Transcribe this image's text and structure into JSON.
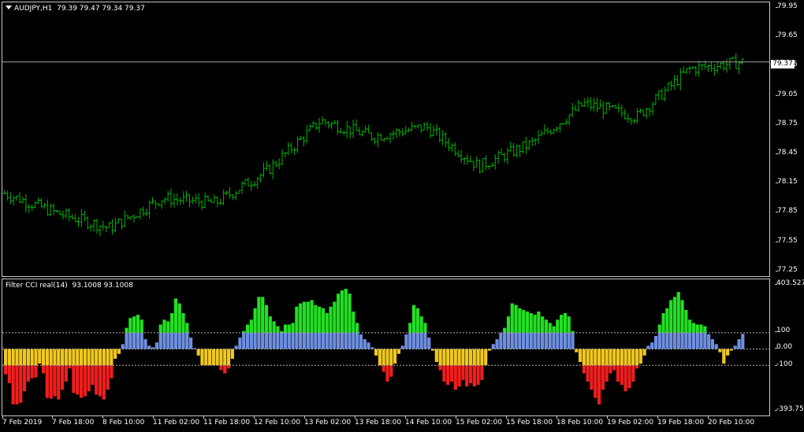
{
  "main": {
    "symbol": "AUDJPY,H1",
    "ohlc": "79.39 79.47 79.34 79.37",
    "current_price": "79.37",
    "price_ticks": [
      "79.95",
      "79.65",
      "79.35",
      "79.05",
      "78.75",
      "78.45",
      "78.15",
      "77.85",
      "77.55",
      "77.25"
    ]
  },
  "indicator": {
    "title": "Filter CCI real(14)",
    "values": "93.1008 93.1008",
    "ticks": [
      "403.5276",
      "100",
      "0.00",
      "-100",
      "-393.7543"
    ]
  },
  "time_labels": [
    "7 Feb 2019",
    "7 Feb 18:00",
    "8 Feb 10:00",
    "11 Feb 02:00",
    "11 Feb 18:00",
    "12 Feb 10:00",
    "13 Feb 02:00",
    "13 Feb 18:00",
    "14 Feb 10:00",
    "15 Feb 02:00",
    "15 Feb 18:00",
    "18 Feb 10:00",
    "19 Feb 02:00",
    "19 Feb 18:00",
    "20 Feb 10:00"
  ],
  "colors": {
    "bars": "#00b400",
    "cci_up_strong": "#22e022",
    "cci_up": "#6e8fe0",
    "cci_down": "#f0c81e",
    "cci_down_strong": "#f01e1e"
  },
  "chart_data": [
    {
      "type": "line",
      "title": "AUDJPY,H1",
      "ylim": [
        77.2,
        79.97
      ],
      "x": [
        "7 Feb 2019",
        "7 Feb 18:00",
        "8 Feb 10:00",
        "11 Feb 02:00",
        "11 Feb 18:00",
        "12 Feb 10:00",
        "13 Feb 02:00",
        "13 Feb 18:00",
        "14 Feb 10:00",
        "15 Feb 02:00",
        "15 Feb 18:00",
        "18 Feb 10:00",
        "19 Feb 02:00",
        "19 Feb 18:00",
        "20 Feb 10:00"
      ],
      "series": [
        {
          "values": [
            78.05,
            77.85,
            77.7,
            78.0,
            77.95,
            78.28,
            78.78,
            78.62,
            78.72,
            78.32,
            78.55,
            78.95,
            78.82,
            79.3,
            79.37
          ]
        }
      ]
    },
    {
      "type": "bar",
      "title": "Filter CCI real(14)",
      "ylim": [
        -393.7543,
        403.5276
      ],
      "values": [
        -155,
        -210,
        -340,
        -340,
        -330,
        -260,
        -200,
        -180,
        -175,
        -90,
        -150,
        -300,
        -305,
        -290,
        -310,
        -250,
        -200,
        -120,
        -270,
        -280,
        -300,
        -290,
        -260,
        -220,
        -280,
        -290,
        -310,
        -250,
        -180,
        -60,
        -30,
        30,
        130,
        190,
        200,
        210,
        180,
        60,
        20,
        10,
        40,
        150,
        180,
        170,
        220,
        310,
        280,
        220,
        160,
        70,
        5,
        -40,
        -100,
        -100,
        -100,
        -100,
        -100,
        -130,
        -150,
        -120,
        -60,
        20,
        70,
        110,
        150,
        180,
        250,
        320,
        320,
        270,
        200,
        170,
        140,
        110,
        150,
        150,
        160,
        260,
        280,
        290,
        290,
        300,
        270,
        260,
        250,
        220,
        260,
        290,
        340,
        360,
        370,
        340,
        230,
        160,
        90,
        60,
        40,
        10,
        -40,
        -100,
        -140,
        -200,
        -170,
        -90,
        -30,
        20,
        90,
        160,
        270,
        250,
        200,
        160,
        70,
        -10,
        -80,
        -130,
        -200,
        -220,
        -200,
        -250,
        -230,
        -190,
        -230,
        -210,
        -230,
        -220,
        -190,
        -100,
        -10,
        30,
        60,
        100,
        130,
        200,
        280,
        270,
        250,
        240,
        230,
        220,
        210,
        230,
        200,
        180,
        160,
        140,
        180,
        210,
        220,
        200,
        110,
        -20,
        -80,
        -150,
        -200,
        -250,
        -300,
        -340,
        -250,
        -200,
        -150,
        -130,
        -200,
        -220,
        -260,
        -240,
        -200,
        -120,
        -90,
        -40,
        20,
        40,
        80,
        150,
        220,
        250,
        300,
        320,
        350,
        300,
        240,
        180,
        160,
        150,
        150,
        140,
        90,
        60,
        30,
        -20,
        -90,
        -40,
        -10,
        20,
        60,
        93
      ]
    }
  ]
}
